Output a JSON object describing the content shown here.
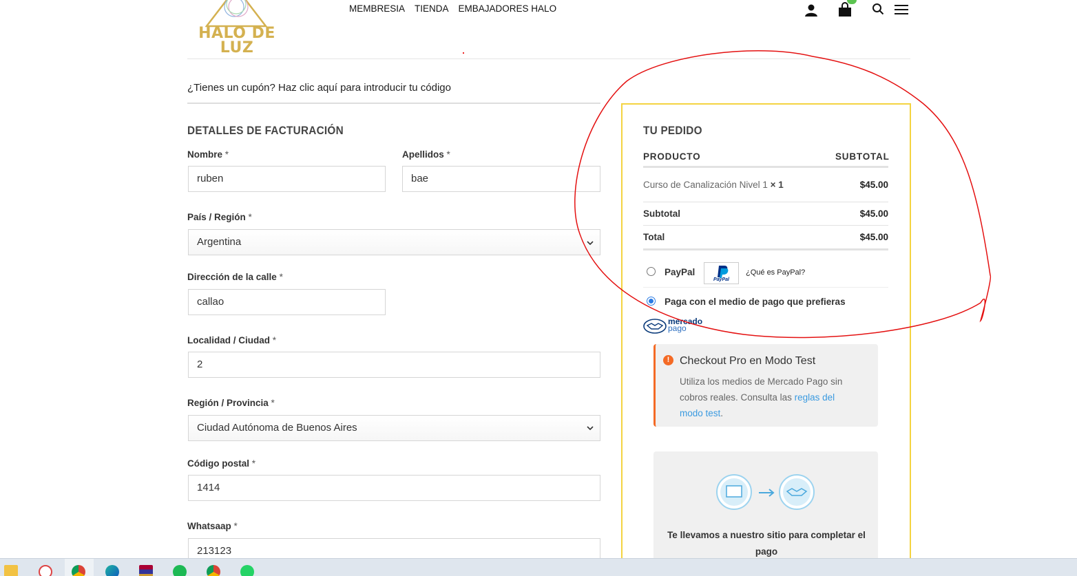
{
  "brand": {
    "logo_text_line1": "HALO DE",
    "logo_text_line2": "LUZ",
    "color_gold": "#d4b150"
  },
  "nav": {
    "items": [
      "MEMBRESIA",
      "TIENDA",
      "EMBAJADORES HALO"
    ]
  },
  "header_icons": [
    "user-icon",
    "cart-icon",
    "search-icon",
    "menu-icon"
  ],
  "coupon": {
    "text": "¿Tienes un cupón? Haz clic aquí para introducir tu código"
  },
  "billing": {
    "title": "DETALLES DE FACTURACIÓN",
    "required_mark": "*",
    "fields": {
      "nombre": {
        "label": "Nombre",
        "value": "ruben"
      },
      "apellidos": {
        "label": "Apellidos",
        "value": "bae"
      },
      "pais": {
        "label": "País / Región",
        "value": "Argentina"
      },
      "direccion": {
        "label": "Dirección de la calle",
        "value": "callao"
      },
      "localidad": {
        "label": "Localidad / Ciudad",
        "value": "2"
      },
      "region": {
        "label": "Región / Provincia",
        "value": "Ciudad Autónoma de Buenos Aires"
      },
      "codigo_postal": {
        "label": "Código postal",
        "value": "1414"
      },
      "whatsapp": {
        "label": "Whatsaap",
        "value": "213123"
      }
    }
  },
  "order": {
    "title": "TU PEDIDO",
    "col_product": "PRODUCTO",
    "col_subtotal": "SUBTOTAL",
    "item": {
      "name": "Curso de Canalización Nivel 1",
      "qty": "× 1",
      "price": "$45.00"
    },
    "subtotal": {
      "label": "Subtotal",
      "value": "$45.00"
    },
    "total": {
      "label": "Total",
      "value": "$45.00"
    },
    "payment": {
      "paypal_label": "PayPal",
      "paypal_help": "¿Qué es PayPal?",
      "paypal_logo_text": "PayPal",
      "mp_label": "Paga con el medio de pago que prefieras",
      "mp_logo_line1": "mercado",
      "mp_logo_line2": "pago",
      "selected": "mercadopago"
    },
    "notice": {
      "icon": "!",
      "title": "Checkout Pro en Modo Test",
      "body": "Utiliza los medios de Mercado Pago sin cobros reales. Consulta las ",
      "link": "reglas del modo test",
      "end": "."
    },
    "redirect_text": "Te llevamos a nuestro sitio para completar el pago",
    "border_color": "#f4d340"
  },
  "taskbar_icons": [
    "file-explorer-icon",
    "paint-icon",
    "chrome-profile-icon",
    "edge-icon",
    "winrar-icon",
    "spotify-icon",
    "chrome-icon",
    "whatsapp-icon"
  ]
}
